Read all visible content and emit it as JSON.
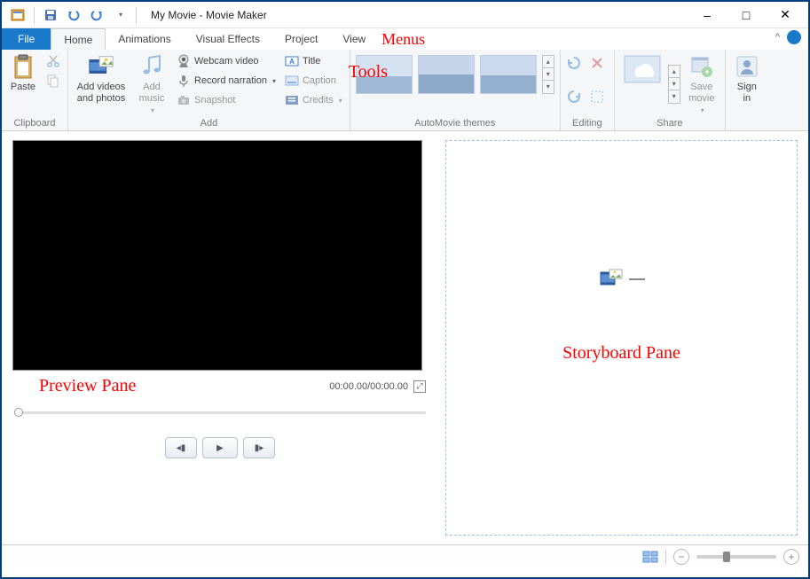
{
  "window": {
    "title": "My Movie - Movie Maker"
  },
  "qat": {
    "save_tip": "Save",
    "undo_tip": "Undo",
    "redo_tip": "Redo"
  },
  "menus": {
    "file": "File",
    "tabs": [
      "Home",
      "Animations",
      "Visual Effects",
      "Project",
      "View"
    ],
    "active": "Home"
  },
  "ribbon": {
    "clipboard": {
      "label": "Clipboard",
      "paste": "Paste",
      "cut_tip": "Cut",
      "copy_tip": "Copy"
    },
    "add": {
      "label": "Add",
      "add_videos": "Add videos\nand photos",
      "add_music": "Add\nmusic",
      "webcam": "Webcam video",
      "narration": "Record narration",
      "snapshot": "Snapshot",
      "title_btn": "Title",
      "caption": "Caption",
      "credits": "Credits"
    },
    "themes": {
      "label": "AutoMovie themes"
    },
    "editing": {
      "label": "Editing",
      "rotate_left_tip": "Rotate left",
      "rotate_right_tip": "Rotate right",
      "delete_tip": "Remove",
      "select_all_tip": "Select all"
    },
    "share": {
      "label": "Share",
      "cloud_tip": "Publish",
      "save_movie": "Save\nmovie",
      "onedrive_tip": "OneDrive"
    },
    "signin": "Sign\nin"
  },
  "preview": {
    "time": "00:00.00/00:00.00"
  },
  "annotations": {
    "menus": "Menus",
    "tools": "Tools",
    "preview": "Preview Pane",
    "storyboard": "Storyboard Pane"
  },
  "icons": {
    "app": "movie-maker-icon",
    "save": "save-icon",
    "undo": "undo-icon",
    "redo": "redo-icon"
  },
  "colors": {
    "accent": "#1979ca",
    "border": "#003d7a",
    "annotation": "#ff0000"
  }
}
